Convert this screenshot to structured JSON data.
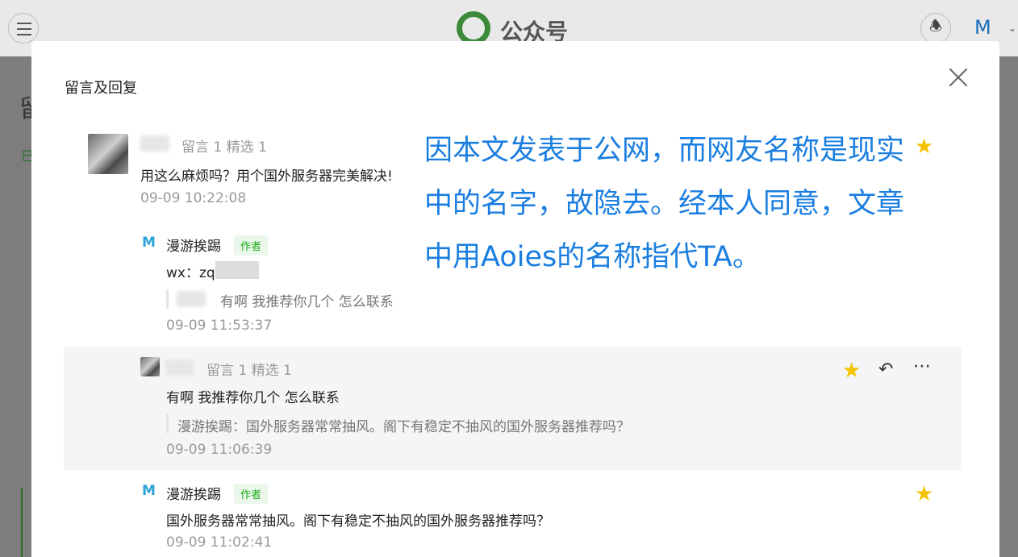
{
  "app": {
    "brand": "公众号"
  },
  "modal": {
    "title": "留言及回复",
    "annotation": "因本文发表于公网，而网友名称是现实中的名字，故隐去。经本人同意，文章中用Aoies的名称指代TA。"
  },
  "comments": [
    {
      "meta": "留言 1   精选 1",
      "text": "用这么麻烦吗？用个国外服务器完美解决!",
      "time": "09-09 10:22:08"
    },
    {
      "author": "漫游挨踢",
      "badge": "作者",
      "text": "wx：zq",
      "quote": "有啊 我推荐你几个 怎么联系",
      "time": "09-09 11:53:37"
    },
    {
      "meta": "留言 1   精选 1",
      "text": "有啊 我推荐你几个 怎么联系",
      "quote": "漫游挨踢：国外服务器常常抽风。阁下有稳定不抽风的国外服务器推荐吗？",
      "time": "09-09 11:06:39"
    },
    {
      "author": "漫游挨踢",
      "badge": "作者",
      "text": "国外服务器常常抽风。阁下有稳定不抽风的国外服务器推荐吗？",
      "time": "09-09 11:02:41"
    }
  ],
  "colors": {
    "accent_green": "#1aad19",
    "star": "#f6c300",
    "annotation_blue": "#1a7ee0"
  }
}
